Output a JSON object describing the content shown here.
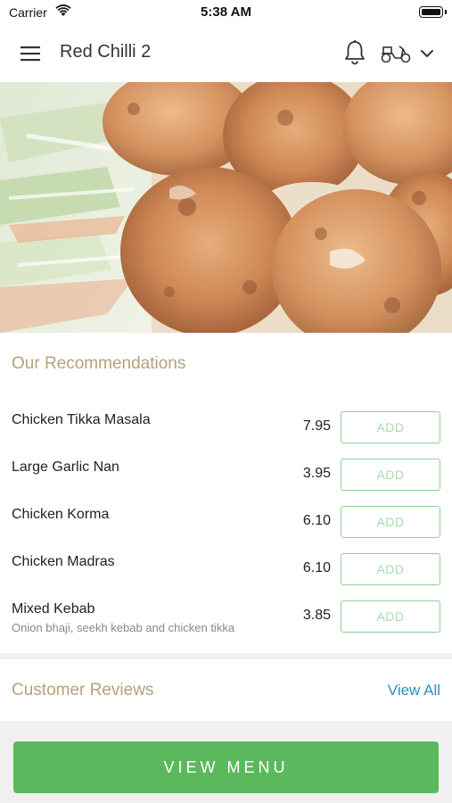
{
  "status_bar": {
    "carrier": "Carrier",
    "time": "5:38 AM",
    "wifi_icon": "wifi-icon",
    "battery_icon": "battery-icon"
  },
  "nav": {
    "title": "Red Chilli 2",
    "menu_icon": "hamburger-menu-icon",
    "bell_icon": "bell-icon",
    "delivery_icon": "scooter-icon",
    "dropdown_icon": "chevron-down-icon"
  },
  "hero": {
    "image": "food-photo-chicken-tikka"
  },
  "recommendations": {
    "title": "Our Recommendations",
    "items": [
      {
        "name": "Chicken Tikka Masala",
        "description": "",
        "price": "7.95",
        "add_label": "ADD"
      },
      {
        "name": "Large Garlic Nan",
        "description": "",
        "price": "3.95",
        "add_label": "ADD"
      },
      {
        "name": "Chicken Korma",
        "description": "",
        "price": "6.10",
        "add_label": "ADD"
      },
      {
        "name": "Chicken Madras",
        "description": "",
        "price": "6.10",
        "add_label": "ADD"
      },
      {
        "name": "Mixed Kebab",
        "description": "Onion bhaji, seekh kebab and chicken tikka",
        "price": "3.85",
        "add_label": "ADD"
      }
    ]
  },
  "reviews": {
    "title": "Customer Reviews",
    "view_all_label": "View All"
  },
  "footer": {
    "view_menu_label": "VIEW MENU"
  },
  "colors": {
    "accent_green": "#5cb85c",
    "section_title": "#b4a27a",
    "link_blue": "#2a8fc1",
    "add_border": "#8fcf96"
  }
}
